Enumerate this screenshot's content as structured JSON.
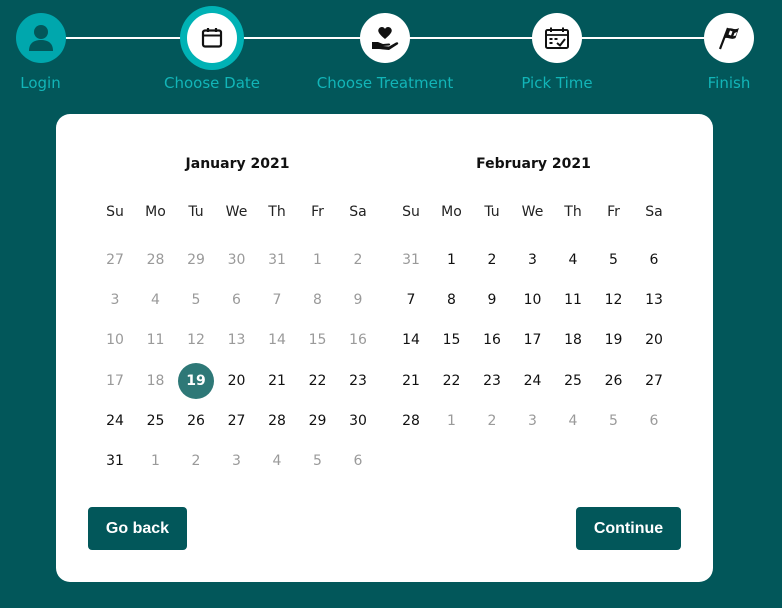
{
  "stepper": {
    "steps": [
      {
        "label": "Login",
        "icon": "user-icon"
      },
      {
        "label": "Choose Date",
        "icon": "calendar-icon"
      },
      {
        "label": "Choose Treatment",
        "icon": "heart-hand-icon"
      },
      {
        "label": "Pick Time",
        "icon": "calendar-check-icon"
      },
      {
        "label": "Finish",
        "icon": "flag-icon"
      }
    ]
  },
  "calendar": {
    "weekdays": [
      "Su",
      "Mo",
      "Tu",
      "We",
      "Th",
      "Fr",
      "Sa"
    ],
    "months": [
      {
        "title": "January 2021",
        "weeks": [
          [
            "27",
            "28",
            "29",
            "30",
            "31",
            "1",
            "2"
          ],
          [
            "3",
            "4",
            "5",
            "6",
            "7",
            "8",
            "9"
          ],
          [
            "10",
            "11",
            "12",
            "13",
            "14",
            "15",
            "16"
          ],
          [
            "17",
            "18",
            "19",
            "20",
            "21",
            "22",
            "23"
          ],
          [
            "24",
            "25",
            "26",
            "27",
            "28",
            "29",
            "30"
          ],
          [
            "31",
            "1",
            "2",
            "3",
            "4",
            "5",
            "6"
          ]
        ]
      },
      {
        "title": "February 2021",
        "weeks": [
          [
            "31",
            "1",
            "2",
            "3",
            "4",
            "5",
            "6"
          ],
          [
            "7",
            "8",
            "9",
            "10",
            "11",
            "12",
            "13"
          ],
          [
            "14",
            "15",
            "16",
            "17",
            "18",
            "19",
            "20"
          ],
          [
            "21",
            "22",
            "23",
            "24",
            "25",
            "26",
            "27"
          ],
          [
            "28",
            "1",
            "2",
            "3",
            "4",
            "5",
            "6"
          ]
        ]
      }
    ],
    "selected": "January 19"
  },
  "actions": {
    "back_label": "Go back",
    "continue_label": "Continue"
  },
  "colors": {
    "background": "#02575a",
    "accent": "#00b2b5",
    "selected_day": "#2e7877",
    "muted_day": "#9a9a9a"
  }
}
